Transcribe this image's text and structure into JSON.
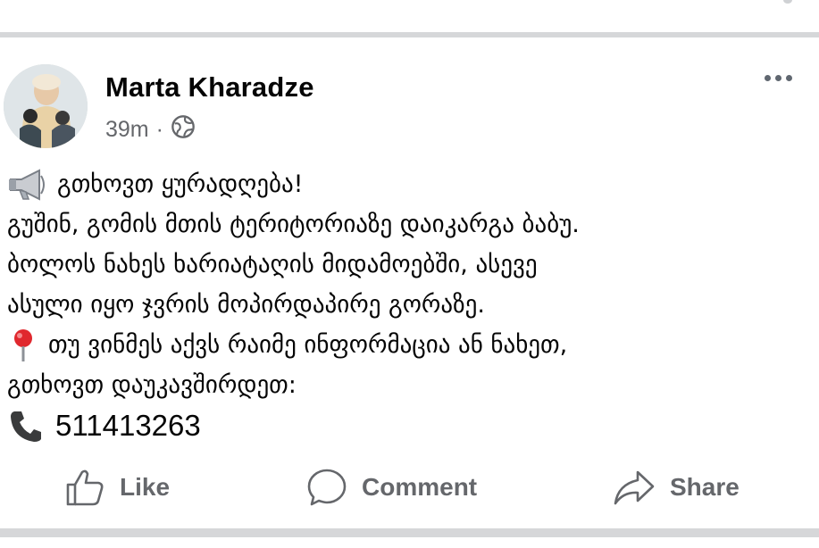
{
  "post": {
    "author": "Marta Kharadze",
    "time": "39m",
    "separator": "·",
    "body_lines": [
      "გთხოვთ ყურადღება!",
      "გუშინ, გომის მთის ტერიტორიაზე დაიკარგა ბაბუ.",
      "ბოლოს ნახეს ხარიატაღის მიდამოებში, ასევე",
      "ასული იყო ჯვრის მოპირდაპირე გორაზე.",
      "თუ ვინმეს აქვს რაიმე ინფორმაცია ან ნახეთ,",
      "გთხოვთ დაუკავშირდეთ:",
      "511413263"
    ]
  },
  "actions": {
    "like": "Like",
    "comment": "Comment",
    "share": "Share"
  },
  "colors": {
    "text": "#050505",
    "secondary": "#65676b",
    "divider": "#d6d7d9"
  },
  "icons": [
    "globe-icon",
    "more-icon",
    "megaphone-icon",
    "pin-icon",
    "phone-icon",
    "like-icon",
    "comment-icon",
    "share-icon"
  ]
}
